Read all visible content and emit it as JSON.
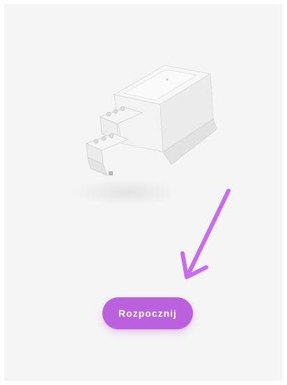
{
  "screen": {
    "background_color": "#f5f5f5",
    "device_image_name": "din-rail-controller-illustration"
  },
  "guide_arrow": {
    "icon": "arrow-down-left-icon",
    "color": "#c76cf0"
  },
  "start_button": {
    "label": "Rozpocznij",
    "color": "#bb61dd",
    "text_color": "#ffffff"
  }
}
